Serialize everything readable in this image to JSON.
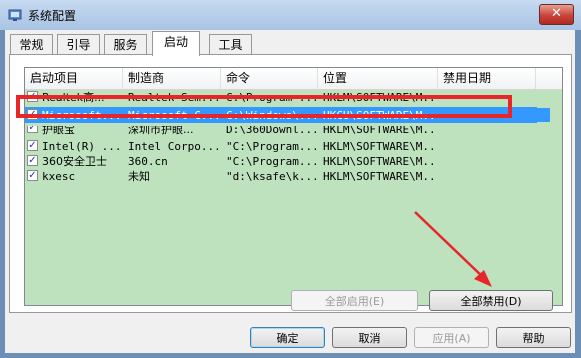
{
  "window": {
    "title": "系统配置",
    "close_label": "✕"
  },
  "tabs": [
    {
      "label": "常规"
    },
    {
      "label": "引导"
    },
    {
      "label": "服务"
    },
    {
      "label": "启动"
    },
    {
      "label": "工具"
    }
  ],
  "active_tab": "启动",
  "list": {
    "columns": [
      "启动项目",
      "制造商",
      "命令",
      "位置",
      "禁用日期"
    ],
    "rows": [
      {
        "checked": true,
        "item": "Realtek高...",
        "maker": "Realtek Sem...",
        "command": "C:\\Program ...",
        "location": "HKLM\\SOFTWARE\\M..."
      },
      {
        "checked": true,
        "item": "Microsoft...",
        "maker": "Microsoft C...",
        "command": "C:\\Windows\\...",
        "location": "HKCU\\SOFTWARE\\M...",
        "selected": true
      },
      {
        "checked": true,
        "item": "护眼宝",
        "maker": "深圳市护眼...",
        "command": "D:\\360Downl...",
        "location": "HKLM\\SOFTWARE\\M..."
      },
      {
        "checked": true,
        "item": "Intel(R) ...",
        "maker": "Intel Corpo...",
        "command": "\"C:\\Program...",
        "location": "HKLM\\SOFTWARE\\M..."
      },
      {
        "checked": true,
        "item": "360安全卫士",
        "maker": "360.cn",
        "command": "\"C:\\Program...",
        "location": "HKLM\\SOFTWARE\\M..."
      },
      {
        "checked": true,
        "item": "kxesc",
        "maker": "未知",
        "command": "\"d:\\ksafe\\k...",
        "location": "HKLM\\SOFTWARE\\M..."
      }
    ]
  },
  "buttons": {
    "enable_all": "全部启用(E)",
    "disable_all": "全部禁用(D)",
    "ok": "确定",
    "cancel": "取消",
    "apply": "应用(A)",
    "help": "帮助"
  },
  "annotation_color": "#e8262a"
}
